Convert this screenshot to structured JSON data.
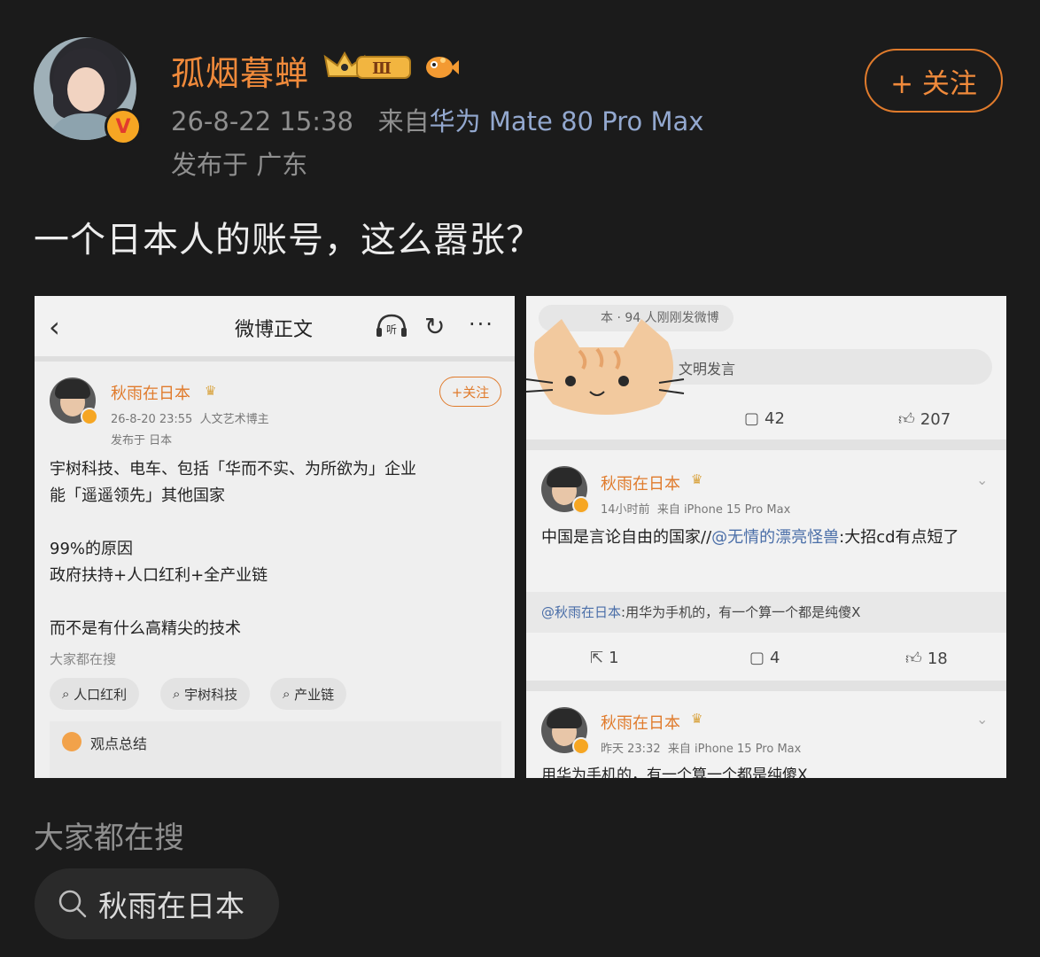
{
  "post": {
    "author": "孤烟暮蝉",
    "level_badge": "Ⅲ",
    "timestamp": "26-8-22 15:38",
    "source_prefix": "来自",
    "device": "华为 Mate 80 Pro Max",
    "location": "发布于 广东",
    "follow_label": "+ 关注",
    "text": "一个日本人的账号，这么嚣张？"
  },
  "left_screenshot": {
    "nav_title": "微博正文",
    "listen_label": "听",
    "author": "秋雨在日本",
    "follow_label": "+关注",
    "timestamp": "26-8-20 23:55",
    "tag": "人文艺术博主",
    "location": "发布于 日本",
    "body": "宇树科技、电车、包括「华而不实、为所欲为」企业\n能「遥遥领先」其他国家\n\n99%的原因\n政府扶持+人口红利+全产业链\n\n而不是有什么高精尖的技术",
    "search_title": "大家都在搜",
    "chips": [
      "人口红利",
      "宇树科技",
      "产业链"
    ],
    "summary_label": "观点总结"
  },
  "right_screenshot": {
    "top_pill": "本 · 94 人刚刚发微博",
    "input_placeholder": "文明发言",
    "post_stats": {
      "comments": "42",
      "likes": "207"
    },
    "comment1": {
      "author": "秋雨在日本",
      "time": "14小时前",
      "source": "来自 iPhone 15 Pro Max",
      "text_before": "中国是言论自由的国家//",
      "mention": "@无情的漂亮怪兽",
      "text_after": ":大招cd有点短了",
      "quote_mention": "@秋雨在日本",
      "quote_text": ":用华为手机的，有一个算一个都是纯傻X",
      "reposts": "1",
      "comments": "4",
      "likes": "18"
    },
    "comment2": {
      "author": "秋雨在日本",
      "time": "昨天 23:32",
      "source": "来自 iPhone 15 Pro Max",
      "text": "用华为手机的，有一个算一个都是纯傻X"
    }
  },
  "footer": {
    "search_title": "大家都在搜",
    "search_chip": "秋雨在日本"
  },
  "colors": {
    "background": "#1b1b1b",
    "accent": "#f08a3b",
    "link": "#93a8cf"
  }
}
